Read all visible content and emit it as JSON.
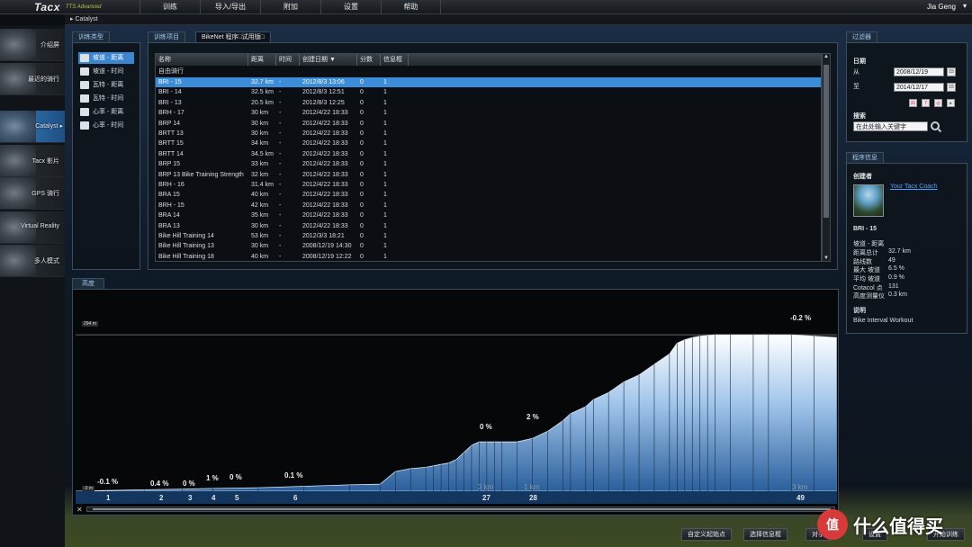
{
  "app": {
    "logo": "Tacx",
    "logo_sub": "TTS Advanced"
  },
  "menu": [
    "训练",
    "导入/导出",
    "附加",
    "设置",
    "帮助"
  ],
  "user": {
    "name": "Jia Geng",
    "caret": "▾"
  },
  "breadcrumb": "Catalyst",
  "leftnav": [
    {
      "label": "介绍屏",
      "icon": "intro-thumbnail"
    },
    {
      "label": "最近的骑行",
      "icon": "recent-rides-thumbnail"
    },
    {
      "label": "Catalyst ▸",
      "icon": "catalyst-thumbnail",
      "active": true
    },
    {
      "label": "Tacx 影片",
      "icon": "film-thumbnail"
    },
    {
      "label": "GPS 骑行",
      "icon": "gps-thumbnail"
    },
    {
      "label": "Virtual Reality",
      "icon": "vr-thumbnail"
    },
    {
      "label": "多人模式",
      "icon": "multiplayer-thumbnail"
    }
  ],
  "training_type": {
    "tab": "训练类型",
    "items": [
      "坡道 - 距离",
      "坡道 - 时间",
      "瓦特 - 距离",
      "瓦特 - 时间",
      "心率 - 距离",
      "心率 - 时间"
    ],
    "selected": 0
  },
  "workouts": {
    "tabs": [
      "训练项目",
      "BikeNet 程序□试用版□"
    ],
    "columns": [
      "名称",
      "距离",
      "时间",
      "创建日期 ▼",
      "分数",
      "信息框"
    ],
    "group": "自由骑行",
    "rows": [
      [
        "BRI - 15",
        "32.7 km",
        "-",
        "2012/8/3 13:06",
        "0",
        "1"
      ],
      [
        "BRI - 14",
        "32.5 km",
        "-",
        "2012/8/3 12:51",
        "0",
        "1"
      ],
      [
        "BRI - 13",
        "20.5 km",
        "-",
        "2012/8/3 12:25",
        "0",
        "1"
      ],
      [
        "BRH - 17",
        "30 km",
        "-",
        "2012/4/22 18:33",
        "0",
        "1"
      ],
      [
        "BRP 14",
        "30 km",
        "-",
        "2012/4/22 18:33",
        "0",
        "1"
      ],
      [
        "BRTT 13",
        "30 km",
        "-",
        "2012/4/22 18:33",
        "0",
        "1"
      ],
      [
        "BRTT 15",
        "34 km",
        "-",
        "2012/4/22 18:33",
        "0",
        "1"
      ],
      [
        "BRTT 14",
        "34.5 km",
        "-",
        "2012/4/22 18:33",
        "0",
        "1"
      ],
      [
        "BRP 15",
        "33 km",
        "-",
        "2012/4/22 18:33",
        "0",
        "1"
      ],
      [
        "BRP 13 Bike Training Strength",
        "32 km",
        "-",
        "2012/4/22 18:33",
        "0",
        "1"
      ],
      [
        "BRH - 16",
        "31.4 km",
        "-",
        "2012/4/22 18:33",
        "0",
        "1"
      ],
      [
        "BRA 15",
        "40 km",
        "-",
        "2012/4/22 18:33",
        "0",
        "1"
      ],
      [
        "BRH - 15",
        "42 km",
        "-",
        "2012/4/22 18:33",
        "0",
        "1"
      ],
      [
        "BRA 14",
        "35 km",
        "-",
        "2012/4/22 18:33",
        "0",
        "1"
      ],
      [
        "BRA 13",
        "30 km",
        "-",
        "2012/4/22 18:33",
        "0",
        "1"
      ],
      [
        "Bike Hill Training 14",
        "53 km",
        "-",
        "2012/3/3 18:21",
        "0",
        "1"
      ],
      [
        "Bike Hill Training 13",
        "30 km",
        "-",
        "2008/12/19 14:30",
        "0",
        "1"
      ],
      [
        "Bike Hill Training 18",
        "40 km",
        "-",
        "2008/12/19 12:22",
        "0",
        "1"
      ]
    ],
    "selected": 0
  },
  "filter": {
    "tab": "过滤器",
    "date_label": "日期",
    "from_label": "从",
    "from_value": "2008/12/19",
    "to_label": "至",
    "to_value": "2014/12/17",
    "search_label": "搜索",
    "search_placeholder": "在此处输入关键字"
  },
  "program_info": {
    "tab": "程序信息",
    "creator_label": "创建者",
    "creator": "Your Tacx Coach",
    "name": "BRI - 15",
    "fields": [
      [
        "坡道 - 距离",
        ""
      ],
      [
        "距离总计",
        "32.7 km"
      ],
      [
        "路线数",
        "49"
      ],
      [
        "最大 坡道",
        "6.5 %"
      ],
      [
        "平均 坡道",
        "0.9 %"
      ],
      [
        "Cotacol 点",
        "131"
      ],
      [
        "高度测量仪",
        "0.3 km"
      ]
    ],
    "desc_label": "说明",
    "desc": "Bike Interval Workout"
  },
  "elevation": {
    "tab": "高度",
    "ymax_label": "294 m",
    "ymin_label": "-3 m",
    "gradients": [
      "-0.1 %",
      "0.4 %",
      "0 %",
      "1 %",
      "0 %",
      "0.1 %",
      "0 %",
      "2 %",
      "-0.2 %"
    ],
    "segments": [
      "1",
      "2",
      "3",
      "4",
      "5",
      "6",
      "27",
      "28",
      "49"
    ],
    "km_labels": [
      "3 km",
      "1 km",
      "3 km"
    ],
    "profile": {
      "x": [
        0,
        0.04,
        0.09,
        0.14,
        0.18,
        0.24,
        0.3,
        0.36,
        0.4,
        0.42,
        0.44,
        0.46,
        0.47,
        0.48,
        0.49,
        0.5,
        0.51,
        0.52,
        0.53,
        0.54,
        0.55,
        0.56,
        0.58,
        0.6,
        0.62,
        0.64,
        0.65,
        0.67,
        0.68,
        0.7,
        0.72,
        0.74,
        0.76,
        0.78,
        0.79,
        0.8,
        0.81,
        0.82,
        0.83,
        0.84,
        0.86,
        0.89,
        0.91,
        0.94,
        0.97,
        1
      ],
      "y": [
        0,
        1,
        2,
        3,
        4,
        5,
        7,
        9,
        10,
        28,
        32,
        34,
        36,
        38,
        40,
        45,
        55,
        65,
        70,
        70,
        70,
        70,
        70,
        75,
        85,
        100,
        110,
        120,
        130,
        140,
        155,
        165,
        180,
        195,
        210,
        215,
        218,
        220,
        221,
        222,
        222,
        222,
        222,
        222,
        220,
        218
      ]
    }
  },
  "bottom_buttons": [
    "自定义起始点",
    "选择信息框",
    "对手",
    "设置",
    "开始训练"
  ],
  "watermark": {
    "badge": "值",
    "text": "什么值得买"
  }
}
